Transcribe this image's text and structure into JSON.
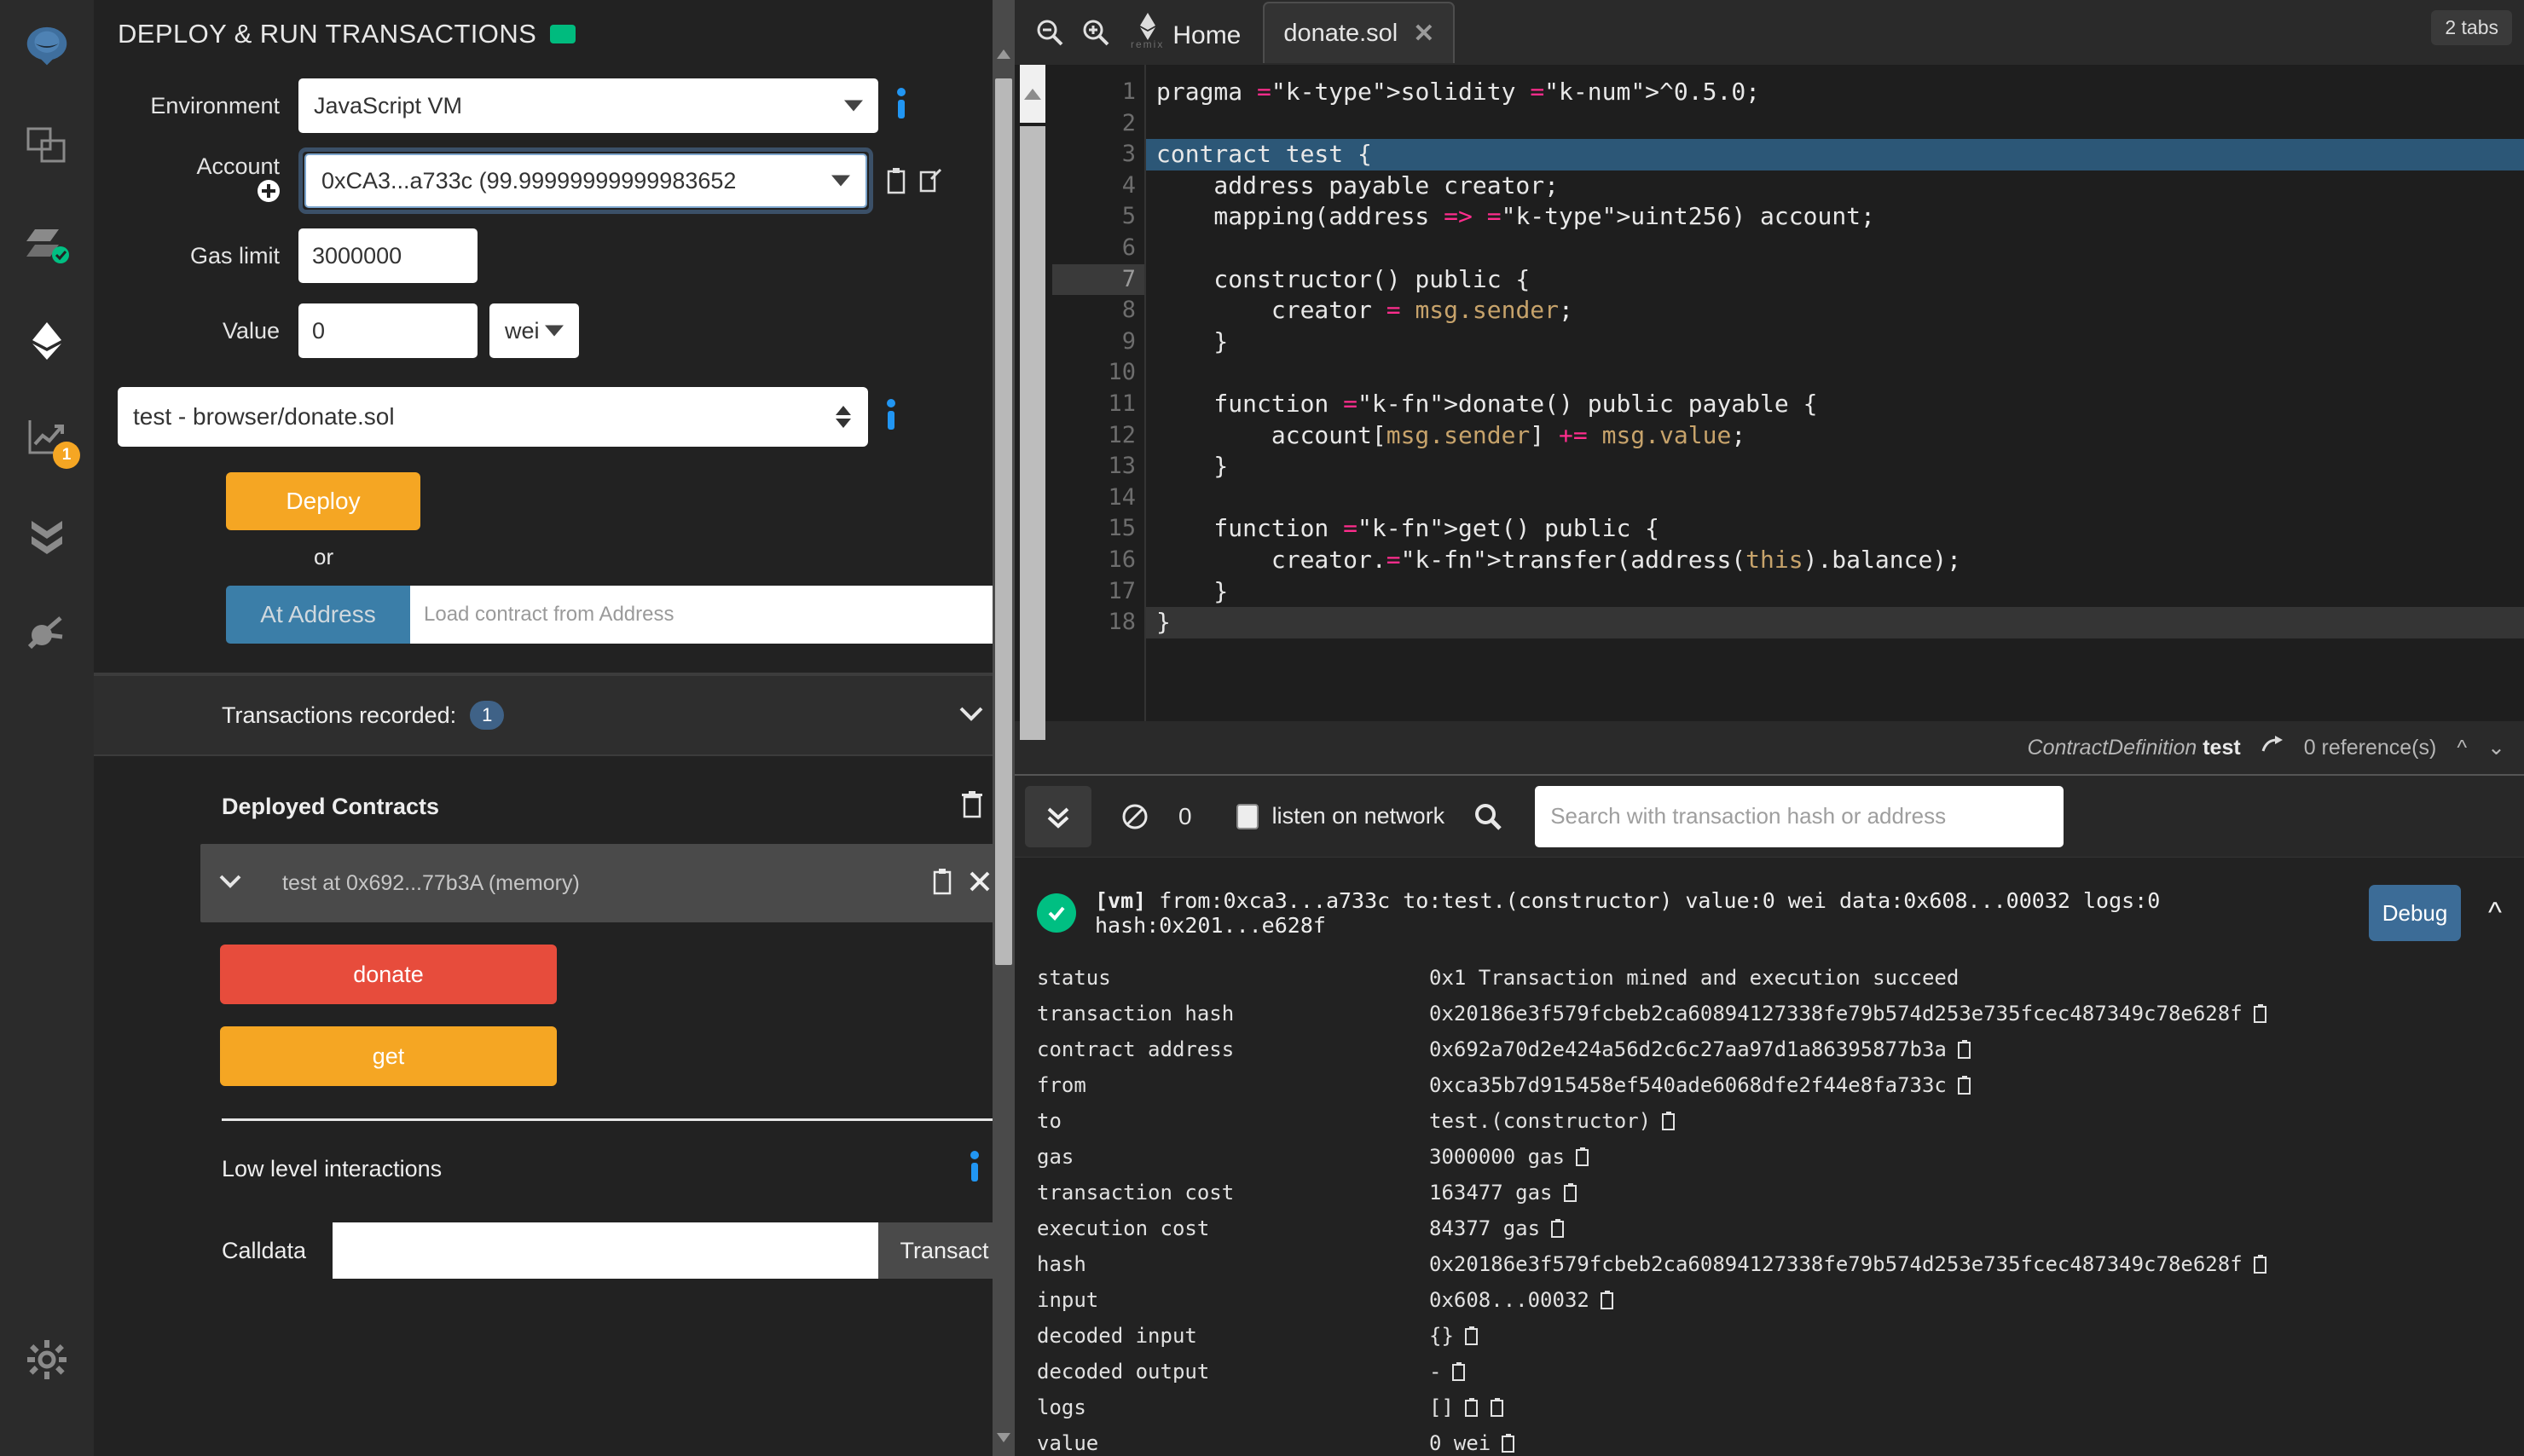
{
  "iconbar": {
    "items": [
      {
        "name": "remix-logo-icon",
        "label": "Remix"
      },
      {
        "name": "file-explorers-icon",
        "label": "File explorers"
      },
      {
        "name": "solidity-compiler-icon",
        "label": "Solidity compiler"
      },
      {
        "name": "deploy-run-icon",
        "label": "Deploy & run transactions"
      },
      {
        "name": "analysis-icon",
        "label": "Solidity static analysis",
        "badge": "1"
      },
      {
        "name": "debugger-icon",
        "label": "Debugger"
      },
      {
        "name": "plugin-manager-icon",
        "label": "Plugin manager"
      },
      {
        "name": "settings-icon",
        "label": "Settings"
      }
    ]
  },
  "panel": {
    "title": "DEPLOY & RUN TRANSACTIONS",
    "environment_label": "Environment",
    "environment_value": "JavaScript VM",
    "account_label": "Account",
    "account_value": "0xCA3...a733c (99.99999999999983652",
    "gas_limit_label": "Gas limit",
    "gas_limit_value": "3000000",
    "value_label": "Value",
    "value_value": "0",
    "value_unit": "wei",
    "contract_value": "test - browser/donate.sol",
    "deploy_label": "Deploy",
    "or_label": "or",
    "at_address_label": "At Address",
    "at_address_placeholder": "Load contract from Address",
    "transactions_recorded_label": "Transactions recorded:",
    "transactions_recorded_count": "1",
    "deployed_contracts_label": "Deployed Contracts",
    "deployed_contract_name": "test at 0x692...77b3A (memory)",
    "fn_donate": "donate",
    "fn_get": "get",
    "low_level_label": "Low level interactions",
    "calldata_label": "Calldata",
    "calldata_value": "",
    "transact_label": "Transact"
  },
  "editor": {
    "home_tab": "Home",
    "remix_sub": "remix",
    "file_tab": "donate.sol",
    "tabs_count": "2 tabs",
    "lines": [
      {
        "n": "1",
        "fold": false,
        "state": "",
        "text": "pragma solidity ^0.5.0;"
      },
      {
        "n": "2",
        "fold": false,
        "state": "",
        "text": ""
      },
      {
        "n": "3",
        "fold": true,
        "state": "hl",
        "text": "contract test {"
      },
      {
        "n": "4",
        "fold": false,
        "state": "",
        "text": "    address payable creator;"
      },
      {
        "n": "5",
        "fold": false,
        "state": "",
        "text": "    mapping(address => uint256) account;"
      },
      {
        "n": "6",
        "fold": false,
        "state": "",
        "text": ""
      },
      {
        "n": "7",
        "fold": true,
        "state": "active",
        "text": "    constructor() public {"
      },
      {
        "n": "8",
        "fold": false,
        "state": "",
        "text": "        creator = msg.sender;"
      },
      {
        "n": "9",
        "fold": false,
        "state": "",
        "text": "    }"
      },
      {
        "n": "10",
        "fold": false,
        "state": "",
        "text": ""
      },
      {
        "n": "11",
        "fold": true,
        "state": "",
        "text": "    function donate() public payable {"
      },
      {
        "n": "12",
        "fold": false,
        "state": "",
        "text": "        account[msg.sender] += msg.value;"
      },
      {
        "n": "13",
        "fold": false,
        "state": "",
        "text": "    }"
      },
      {
        "n": "14",
        "fold": false,
        "state": "",
        "text": ""
      },
      {
        "n": "15",
        "fold": true,
        "state": "",
        "text": "    function get() public {"
      },
      {
        "n": "16",
        "fold": false,
        "state": "",
        "text": "        creator.transfer(address(this).balance);"
      },
      {
        "n": "17",
        "fold": false,
        "state": "",
        "text": "    }"
      },
      {
        "n": "18",
        "fold": false,
        "state": "last",
        "text": "}"
      }
    ],
    "status_contractdefinition": "ContractDefinition",
    "status_contract_name": "test",
    "status_references": "0 reference(s)"
  },
  "terminal": {
    "pending_count": "0",
    "listen_label": "listen on network",
    "search_placeholder": "Search with transaction hash or address",
    "tx_summary_prefix": "[vm]",
    "tx_summary": "from:0xca3...a733c to:test.(constructor) value:0 wei data:0x608...00032 logs:0 hash:0x201...e628f",
    "debug_label": "Debug",
    "rows": [
      {
        "k": "status",
        "v": "0x1 Transaction mined and execution succeed",
        "copies": 0
      },
      {
        "k": "transaction hash",
        "v": "0x20186e3f579fcbeb2ca60894127338fe79b574d253e735fcec487349c78e628f",
        "copies": 1
      },
      {
        "k": "contract address",
        "v": "0x692a70d2e424a56d2c6c27aa97d1a86395877b3a",
        "copies": 1
      },
      {
        "k": "from",
        "v": "0xca35b7d915458ef540ade6068dfe2f44e8fa733c",
        "copies": 1
      },
      {
        "k": "to",
        "v": "test.(constructor)",
        "copies": 1
      },
      {
        "k": "gas",
        "v": "3000000 gas",
        "copies": 1
      },
      {
        "k": "transaction cost",
        "v": "163477 gas",
        "copies": 1
      },
      {
        "k": "execution cost",
        "v": "84377 gas",
        "copies": 1
      },
      {
        "k": "hash",
        "v": "0x20186e3f579fcbeb2ca60894127338fe79b574d253e735fcec487349c78e628f",
        "copies": 1
      },
      {
        "k": "input",
        "v": "0x608...00032",
        "copies": 1
      },
      {
        "k": "decoded input",
        "v": "{}",
        "copies": 1
      },
      {
        "k": "decoded output",
        "v": "-",
        "copies": 1
      },
      {
        "k": "logs",
        "v": "[]",
        "copies": 2
      },
      {
        "k": "value",
        "v": "0 wei",
        "copies": 1
      }
    ]
  },
  "colors": {
    "accent_orange": "#f5a623",
    "accent_red": "#e74c3c",
    "accent_blue": "#3b7ea8",
    "success_green": "#00bf82"
  }
}
